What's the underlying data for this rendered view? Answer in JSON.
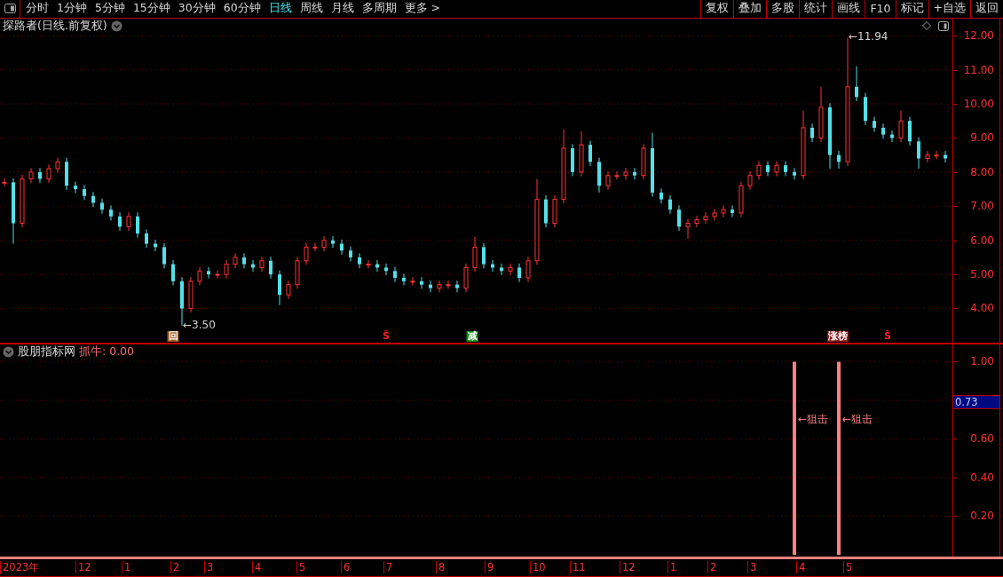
{
  "toolbar": {
    "periods": [
      {
        "label": "分时",
        "selected": false
      },
      {
        "label": "1分钟",
        "selected": false
      },
      {
        "label": "5分钟",
        "selected": false
      },
      {
        "label": "15分钟",
        "selected": false
      },
      {
        "label": "30分钟",
        "selected": false
      },
      {
        "label": "60分钟",
        "selected": false
      },
      {
        "label": "日线",
        "selected": true
      },
      {
        "label": "周线",
        "selected": false
      },
      {
        "label": "月线",
        "selected": false
      },
      {
        "label": "多周期",
        "selected": false
      },
      {
        "label": "更多 >",
        "selected": false
      }
    ],
    "buttons": [
      "复权",
      "叠加",
      "多股",
      "统计",
      "画线",
      "F10",
      "标记",
      "+自选",
      "返回"
    ]
  },
  "price_panel": {
    "title": "探路者(日线.前复权)",
    "chart_data": {
      "type": "candlestick",
      "ylim": [
        3.0,
        12.03
      ],
      "yticks": [
        {
          "value": 4,
          "label": "4.00"
        },
        {
          "value": 5,
          "label": "5.00"
        },
        {
          "value": 6,
          "label": "6.00"
        },
        {
          "value": 7,
          "label": "7.00"
        },
        {
          "value": 8,
          "label": "8.00"
        },
        {
          "value": 9,
          "label": "9.00"
        },
        {
          "value": 10,
          "label": "10.00"
        },
        {
          "value": 11,
          "label": "11.00"
        },
        {
          "value": 12,
          "label": "12.00"
        }
      ],
      "grid": true,
      "ohlc": [
        [
          7.7,
          7.82,
          7.58,
          7.7
        ],
        [
          7.7,
          7.82,
          5.9,
          6.5
        ],
        [
          6.5,
          7.92,
          6.38,
          7.8
        ],
        [
          7.8,
          8.12,
          7.68,
          8.0
        ],
        [
          8.0,
          8.12,
          7.68,
          7.8
        ],
        [
          7.8,
          8.22,
          7.68,
          8.1
        ],
        [
          8.1,
          8.42,
          7.98,
          8.3
        ],
        [
          8.3,
          8.42,
          7.48,
          7.6
        ],
        [
          7.6,
          7.72,
          7.38,
          7.5
        ],
        [
          7.5,
          7.62,
          7.18,
          7.3
        ],
        [
          7.3,
          7.42,
          6.98,
          7.1
        ],
        [
          7.1,
          7.22,
          6.78,
          6.9
        ],
        [
          6.9,
          7.02,
          6.58,
          6.7
        ],
        [
          6.7,
          6.82,
          6.28,
          6.4
        ],
        [
          6.4,
          6.82,
          6.28,
          6.7
        ],
        [
          6.7,
          6.82,
          6.08,
          6.2
        ],
        [
          6.2,
          6.32,
          5.78,
          5.9
        ],
        [
          5.9,
          6.02,
          5.68,
          5.8
        ],
        [
          5.8,
          5.92,
          5.18,
          5.3
        ],
        [
          5.3,
          5.42,
          4.68,
          4.8
        ],
        [
          4.8,
          4.92,
          3.5,
          4.0
        ],
        [
          4.0,
          4.92,
          3.88,
          4.8
        ],
        [
          4.8,
          5.22,
          4.68,
          5.1
        ],
        [
          5.1,
          5.22,
          4.88,
          5.0
        ],
        [
          5.0,
          5.12,
          4.88,
          5.0
        ],
        [
          5.0,
          5.42,
          4.88,
          5.3
        ],
        [
          5.3,
          5.62,
          5.18,
          5.5
        ],
        [
          5.5,
          5.62,
          5.18,
          5.3
        ],
        [
          5.3,
          5.42,
          5.08,
          5.2
        ],
        [
          5.2,
          5.52,
          5.08,
          5.4
        ],
        [
          5.4,
          5.52,
          4.88,
          5.0
        ],
        [
          5.0,
          5.12,
          4.1,
          4.4
        ],
        [
          4.4,
          4.82,
          4.28,
          4.7
        ],
        [
          4.7,
          5.52,
          4.58,
          5.4
        ],
        [
          5.4,
          5.92,
          5.28,
          5.8
        ],
        [
          5.8,
          5.92,
          5.68,
          5.8
        ],
        [
          5.8,
          6.12,
          5.68,
          6.0
        ],
        [
          6.0,
          6.12,
          5.78,
          5.9
        ],
        [
          5.9,
          6.02,
          5.58,
          5.7
        ],
        [
          5.7,
          5.82,
          5.38,
          5.5
        ],
        [
          5.5,
          5.62,
          5.18,
          5.3
        ],
        [
          5.3,
          5.42,
          5.18,
          5.3
        ],
        [
          5.3,
          5.42,
          5.08,
          5.2
        ],
        [
          5.2,
          5.32,
          4.98,
          5.1
        ],
        [
          5.1,
          5.22,
          4.78,
          4.9
        ],
        [
          4.9,
          5.02,
          4.68,
          4.8
        ],
        [
          4.8,
          4.92,
          4.68,
          4.8
        ],
        [
          4.8,
          4.92,
          4.58,
          4.7
        ],
        [
          4.7,
          4.82,
          4.48,
          4.6
        ],
        [
          4.6,
          4.82,
          4.48,
          4.7
        ],
        [
          4.7,
          4.82,
          4.58,
          4.7
        ],
        [
          4.7,
          4.82,
          4.48,
          4.6
        ],
        [
          4.6,
          5.32,
          4.48,
          5.2
        ],
        [
          5.2,
          6.1,
          5.08,
          5.8
        ],
        [
          5.8,
          5.92,
          5.18,
          5.3
        ],
        [
          5.3,
          5.42,
          5.08,
          5.2
        ],
        [
          5.2,
          5.32,
          4.98,
          5.1
        ],
        [
          5.1,
          5.32,
          4.98,
          5.2
        ],
        [
          5.2,
          5.32,
          4.78,
          4.9
        ],
        [
          4.9,
          5.52,
          4.78,
          5.4
        ],
        [
          5.4,
          7.8,
          5.28,
          7.2
        ],
        [
          7.2,
          7.32,
          6.38,
          6.5
        ],
        [
          6.5,
          7.32,
          6.38,
          7.2
        ],
        [
          7.2,
          9.25,
          7.08,
          8.7
        ],
        [
          8.7,
          8.82,
          7.88,
          8.0
        ],
        [
          8.0,
          9.2,
          7.88,
          8.8
        ],
        [
          8.8,
          8.92,
          8.18,
          8.3
        ],
        [
          8.3,
          8.42,
          7.4,
          7.6
        ],
        [
          7.6,
          8.02,
          7.48,
          7.9
        ],
        [
          7.9,
          8.02,
          7.78,
          7.9
        ],
        [
          7.9,
          8.12,
          7.78,
          8.0
        ],
        [
          8.0,
          8.12,
          7.78,
          7.9
        ],
        [
          7.9,
          8.82,
          7.78,
          8.7
        ],
        [
          8.7,
          9.15,
          7.28,
          7.4
        ],
        [
          7.4,
          7.52,
          7.08,
          7.2
        ],
        [
          7.2,
          7.32,
          6.78,
          6.9
        ],
        [
          6.9,
          7.02,
          6.28,
          6.4
        ],
        [
          6.4,
          6.62,
          6.05,
          6.5
        ],
        [
          6.5,
          6.72,
          6.38,
          6.6
        ],
        [
          6.6,
          6.82,
          6.48,
          6.7
        ],
        [
          6.7,
          6.92,
          6.58,
          6.8
        ],
        [
          6.8,
          7.02,
          6.68,
          6.9
        ],
        [
          6.9,
          7.02,
          6.68,
          6.8
        ],
        [
          6.8,
          7.72,
          6.68,
          7.6
        ],
        [
          7.6,
          8.02,
          7.48,
          7.9
        ],
        [
          7.9,
          8.32,
          7.78,
          8.2
        ],
        [
          8.2,
          8.32,
          7.88,
          8.0
        ],
        [
          8.0,
          8.32,
          7.88,
          8.2
        ],
        [
          8.2,
          8.32,
          7.88,
          8.0
        ],
        [
          8.0,
          8.12,
          7.78,
          7.9
        ],
        [
          7.9,
          9.8,
          7.78,
          9.3
        ],
        [
          9.3,
          9.42,
          8.88,
          9.0
        ],
        [
          9.0,
          10.5,
          8.88,
          9.9
        ],
        [
          9.9,
          10.02,
          8.1,
          8.5
        ],
        [
          8.5,
          8.62,
          8.1,
          8.3
        ],
        [
          8.3,
          11.94,
          8.18,
          10.5
        ],
        [
          10.5,
          11.1,
          10.08,
          10.2
        ],
        [
          10.2,
          10.32,
          9.38,
          9.5
        ],
        [
          9.5,
          9.62,
          9.18,
          9.3
        ],
        [
          9.3,
          9.42,
          8.98,
          9.1
        ],
        [
          9.1,
          9.22,
          8.88,
          9.0
        ],
        [
          9.0,
          9.8,
          8.88,
          9.5
        ],
        [
          9.5,
          9.62,
          8.78,
          8.9
        ],
        [
          8.9,
          9.02,
          8.1,
          8.4
        ],
        [
          8.4,
          8.62,
          8.28,
          8.5
        ],
        [
          8.5,
          8.62,
          8.38,
          8.5
        ],
        [
          8.5,
          8.62,
          8.28,
          8.4
        ]
      ],
      "annotations": [
        "←3.50",
        "←11.94"
      ]
    },
    "markers": [
      {
        "text": "回",
        "kind": "box",
        "color": "#a0561e"
      },
      {
        "text": "Ŝ",
        "kind": "plain",
        "color": "#ff2020"
      },
      {
        "text": "减",
        "kind": "box",
        "color": "#118a11"
      },
      {
        "text": "涨榜",
        "kind": "box",
        "color": "#8b1a1a"
      },
      {
        "text": "Ŝ",
        "kind": "plain",
        "color": "#ff2020"
      }
    ]
  },
  "indicator_panel": {
    "name": "股朋指标网",
    "reading": "抓牛: 0.00",
    "current_value": "0.73",
    "chart_data": {
      "type": "bar",
      "grid": true,
      "ylim": [
        0,
        1.09
      ],
      "yticks": [
        {
          "value": 0.2,
          "label": "0.20"
        },
        {
          "value": 0.4,
          "label": "0.40"
        },
        {
          "value": 0.6,
          "label": "0.60"
        },
        {
          "value": 1.0,
          "label": "1.00"
        }
      ],
      "values": [
        0,
        0,
        0,
        0,
        0,
        0,
        0,
        0,
        0,
        0,
        0,
        0,
        0,
        0,
        0,
        0,
        0,
        0,
        0,
        0,
        0,
        0,
        0,
        0,
        0,
        0,
        0,
        0,
        0,
        0,
        0,
        0,
        0,
        0,
        0,
        0,
        0,
        0,
        0,
        0,
        0,
        0,
        0,
        0,
        0,
        0,
        0,
        0,
        0,
        0,
        0,
        0,
        0,
        0,
        0,
        0,
        0,
        0,
        0,
        0,
        0,
        0,
        0,
        0,
        0,
        0,
        0,
        0,
        0,
        0,
        0,
        0,
        0,
        0,
        0,
        0,
        0,
        0,
        0,
        0,
        0,
        0,
        0,
        0,
        0,
        0,
        0,
        0,
        0,
        1,
        0,
        0,
        0,
        0,
        1,
        0,
        0,
        0,
        0,
        0,
        0,
        0,
        0,
        0,
        0,
        0,
        0
      ],
      "color": "#ff8080",
      "annotations": [
        "←狙击",
        "←狙击"
      ]
    }
  },
  "date_axis": [
    "2023年",
    "12",
    "1",
    "2",
    "3",
    "4",
    "5",
    "6",
    "7",
    "8",
    "9",
    "10",
    "11",
    "12",
    "1",
    "2",
    "3",
    "4",
    "5"
  ]
}
